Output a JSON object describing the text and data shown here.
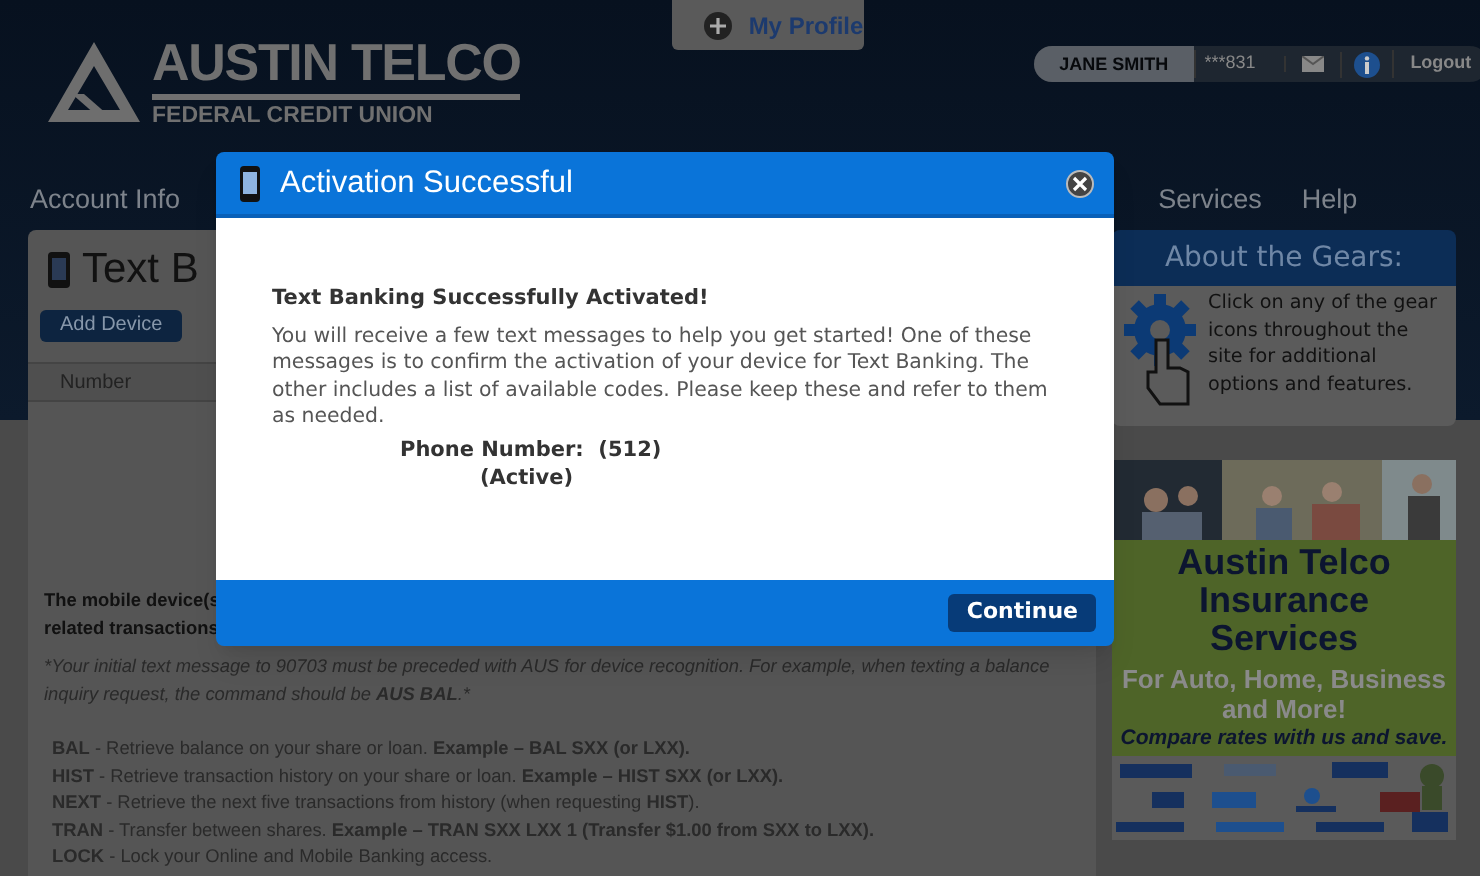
{
  "header": {
    "logo_title": "AUSTIN TELCO",
    "logo_subtitle": "FEDERAL CREDIT UNION",
    "profile_tab": "My Profile",
    "user_bar": {
      "name": "JANE SMITH",
      "account": "***831",
      "logout": "Logout"
    }
  },
  "nav": [
    "Account Info",
    "Services",
    "Help"
  ],
  "panel": {
    "title": "Text B",
    "add_button": "Add Device",
    "table": {
      "columns": [
        "Number"
      ]
    },
    "notice_lines": [
      "The mobile device(s",
      "related transactions"
    ],
    "note": "*Your initial text message to 90703 must be preceded with AUS for device recognition. For example, when texting a balance inquiry request, the command should be **AUS BAL**.*",
    "commands": [
      "**BAL** - Retrieve balance on your share or loan. **Example – BAL SXX (or LXX).**",
      "**HIST** - Retrieve transaction history on your share or loan. **Example – HIST SXX (or LXX).**",
      "**NEXT** - Retrieve the next five transactions from history (when requesting **HIST**).",
      "**TRAN** - Transfer between shares. **Example – TRAN SXX LXX 1 (Transfer $1.00 from SXX to LXX).**",
      "**LOCK** - Lock your Online and Mobile Banking access."
    ]
  },
  "sidebar": {
    "gears_title": "About the Gears:",
    "gears_text": "Click on any of the gear icons throughout the site for additional options and features.",
    "ad": {
      "title": "Austin Telco Insurance Services",
      "subtitle": "For Auto, Home, Business and More!",
      "tagline": "Compare rates with us and save."
    }
  },
  "modal": {
    "title": "Activation Successful",
    "heading": "Text Banking Successfully Activated!",
    "message": "You will receive a few text messages to help you get started! One of these messages is to confirm the activation of your device for Text Banking. The other includes a list of available codes. Please keep these and refer to them as needed.",
    "phone_label": "Phone Number:  (512)",
    "status": "(Active)",
    "button": "Continue"
  }
}
